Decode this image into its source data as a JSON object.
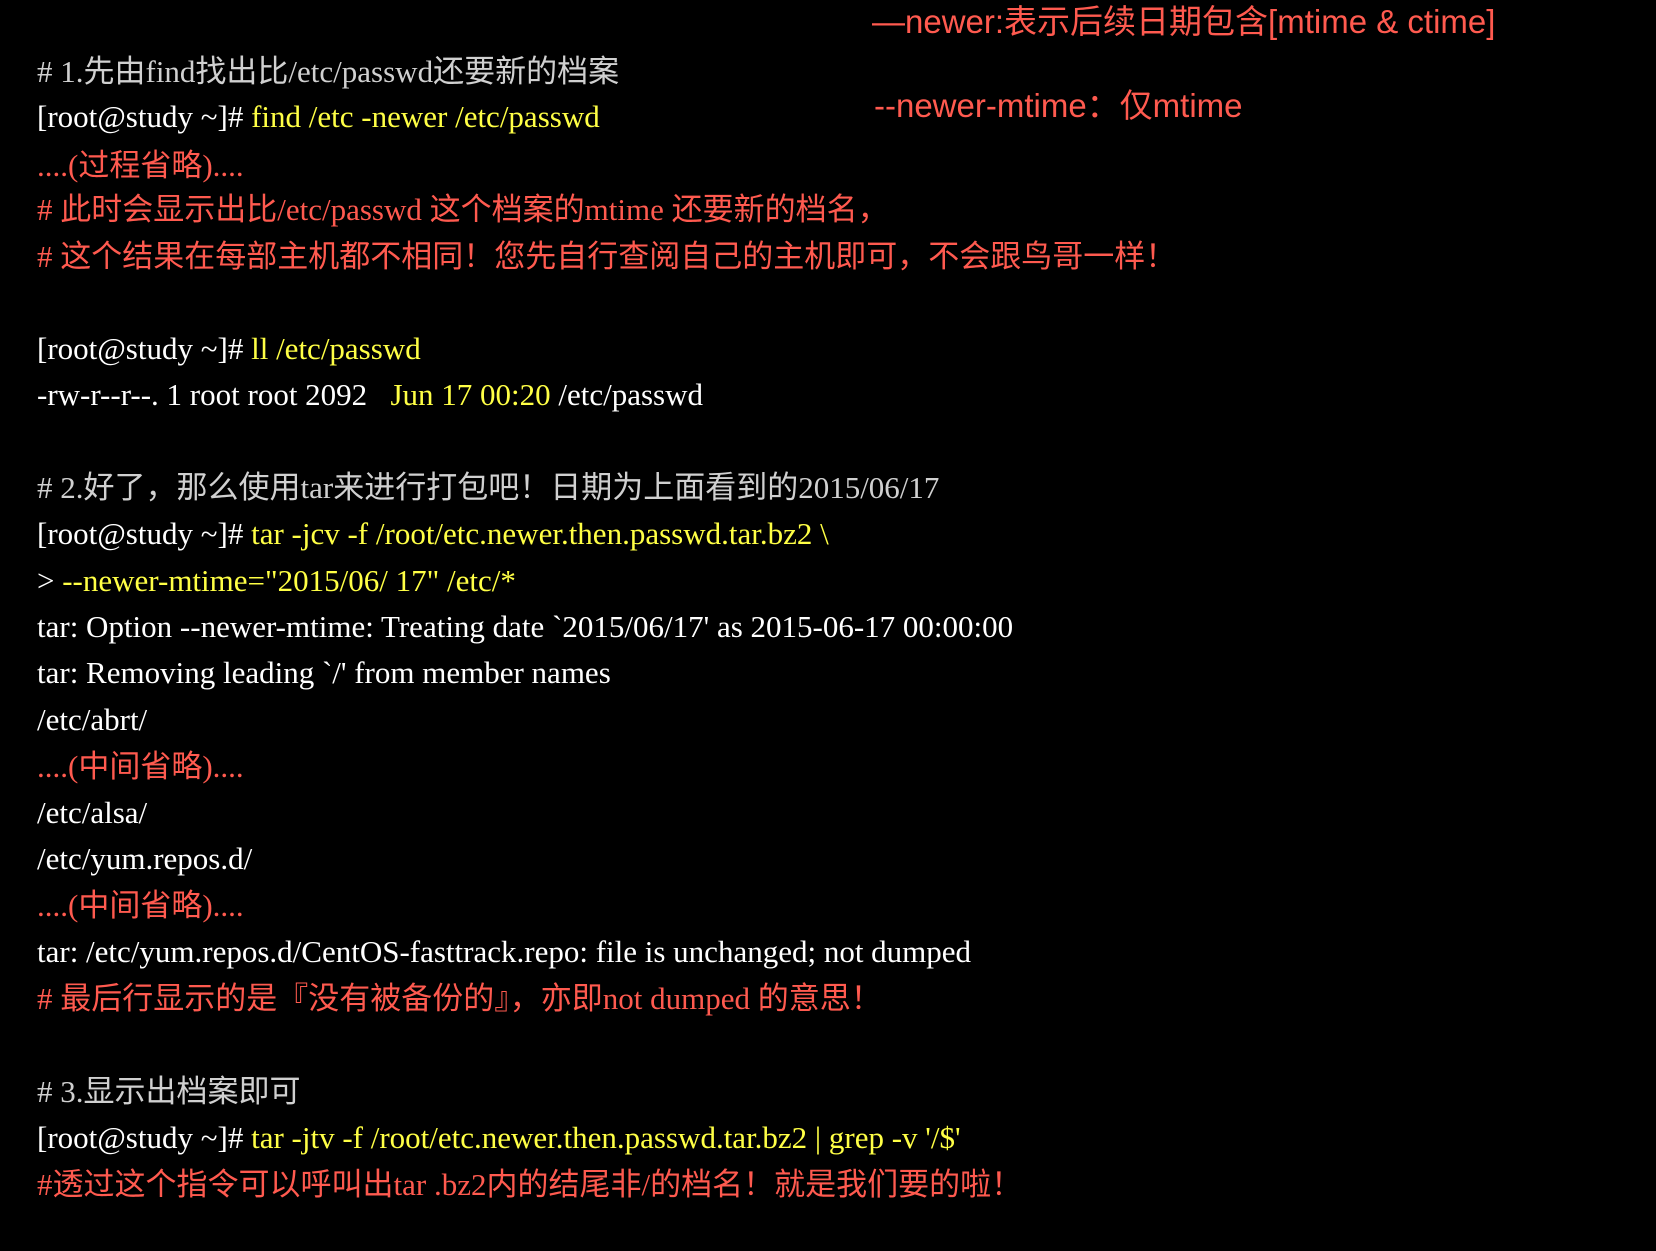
{
  "colors": {
    "background": "#000000",
    "comment_gray": "#d0d0d0",
    "text_white": "#ffffff",
    "command_yellow": "#ffff45",
    "annotation_red": "#ff5a4f"
  },
  "annotations": {
    "newer_note": "—newer:表示后续日期包含[mtime & ctime]",
    "newer_mtime_note": "--newer-mtime：仅mtime"
  },
  "lines": [
    {
      "segments": [
        {
          "text": "# 1.先由find找出比/etc/passwd还要新的档案",
          "color": "gray"
        }
      ]
    },
    {
      "segments": [
        {
          "text": "[root@study ~]# ",
          "color": "white"
        },
        {
          "text": "find /etc -newer /etc/passwd",
          "color": "yellow"
        }
      ]
    },
    {
      "segments": [
        {
          "text": "....(过程省略)....",
          "color": "red"
        }
      ]
    },
    {
      "segments": [
        {
          "text": "# 此时会显示出比/etc/passwd 这个档案的mtime 还要新的档名，",
          "color": "red"
        }
      ]
    },
    {
      "segments": [
        {
          "text": "# 这个结果在每部主机都不相同！您先自行查阅自己的主机即可，不会跟鸟哥一样！",
          "color": "red"
        }
      ]
    },
    {
      "segments": [
        {
          "text": "[root@study ~]# ",
          "color": "white"
        },
        {
          "text": "ll /etc/passwd",
          "color": "yellow"
        }
      ]
    },
    {
      "segments": [
        {
          "text": "-rw-r--r--. 1 root root 2092   ",
          "color": "white"
        },
        {
          "text": "Jun 17 00:20",
          "color": "yellow"
        },
        {
          "text": " /etc/passwd",
          "color": "white"
        }
      ]
    },
    {
      "segments": [
        {
          "text": "# 2.好了，那么使用tar来进行打包吧！日期为上面看到的2015/06/17",
          "color": "gray"
        }
      ]
    },
    {
      "segments": [
        {
          "text": "[root@study ~]# ",
          "color": "white"
        },
        {
          "text": "tar -jcv -f /root/etc.newer.then.passwd.tar.bz2 \\",
          "color": "yellow"
        }
      ]
    },
    {
      "segments": [
        {
          "text": "> ",
          "color": "white"
        },
        {
          "text": "--newer-mtime=\"2015/06/ 17\" /etc/*",
          "color": "yellow"
        }
      ]
    },
    {
      "segments": [
        {
          "text": "tar: Option --newer-mtime: Treating date `2015/06/17' as 2015-06-17 00:00:00",
          "color": "white"
        }
      ]
    },
    {
      "segments": [
        {
          "text": "tar: Removing leading `/' from member names",
          "color": "white"
        }
      ]
    },
    {
      "segments": [
        {
          "text": "/etc/abrt/",
          "color": "white"
        }
      ]
    },
    {
      "segments": [
        {
          "text": "....(中间省略)....",
          "color": "red"
        }
      ]
    },
    {
      "segments": [
        {
          "text": "/etc/alsa/",
          "color": "white"
        }
      ]
    },
    {
      "segments": [
        {
          "text": "/etc/yum.repos.d/",
          "color": "white"
        }
      ]
    },
    {
      "segments": [
        {
          "text": "....(中间省略)....",
          "color": "red"
        }
      ]
    },
    {
      "segments": [
        {
          "text": "tar: /etc/yum.repos.d/CentOS-fasttrack.repo: file is unchanged; not dumped",
          "color": "white"
        }
      ]
    },
    {
      "segments": [
        {
          "text": "# 最后行显示的是『没有被备份的』，亦即not dumped 的意思！",
          "color": "red"
        }
      ]
    },
    {
      "segments": [
        {
          "text": "# 3.显示出档案即可",
          "color": "gray"
        }
      ]
    },
    {
      "segments": [
        {
          "text": "[root@study ~]# ",
          "color": "white"
        },
        {
          "text": "tar -jtv -f /root/etc.newer.then.passwd.tar.bz2 | grep -v '/$'",
          "color": "yellow"
        }
      ]
    },
    {
      "segments": [
        {
          "text": "#透过这个指令可以呼叫出tar .bz2内的结尾非/的档名！就是我们要的啦！",
          "color": "red"
        }
      ]
    }
  ]
}
